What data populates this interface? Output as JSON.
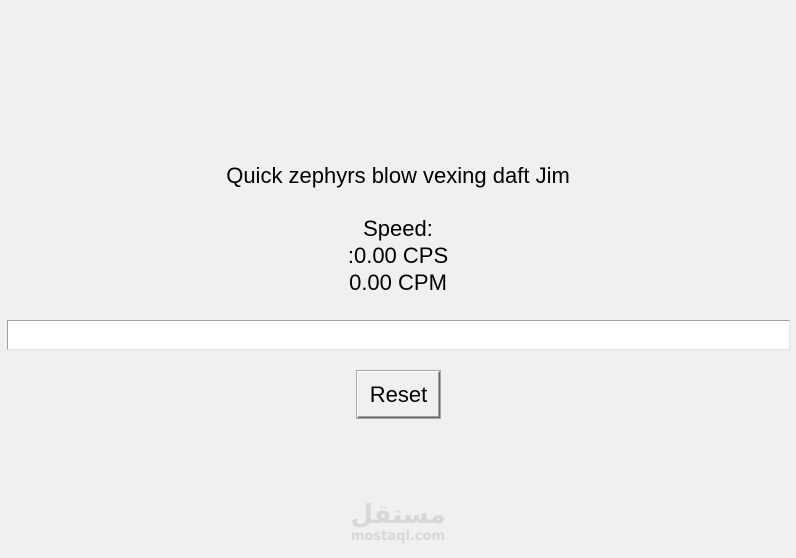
{
  "prompt": {
    "sentence": "Quick zephyrs blow vexing daft Jim"
  },
  "speed": {
    "label": "Speed:",
    "cps": ":0.00 CPS",
    "cpm": "0.00 CPM"
  },
  "entry": {
    "value": ""
  },
  "controls": {
    "reset_label": "Reset"
  },
  "watermark": {
    "logo": "مستقل",
    "domain": "mostaql.com"
  }
}
